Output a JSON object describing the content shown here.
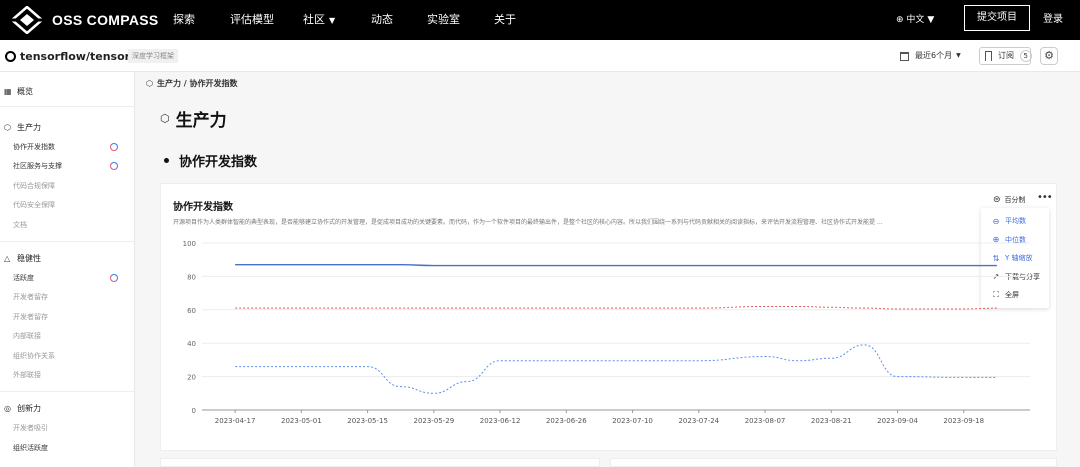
{
  "nav": {
    "logo_text": "OSS COMPASS",
    "items": [
      {
        "label": "探索",
        "dropdown": false
      },
      {
        "label": "评估模型",
        "dropdown": false
      },
      {
        "label": "社区",
        "dropdown": true
      },
      {
        "label": "动态",
        "dropdown": false
      },
      {
        "label": "实验室",
        "dropdown": false
      },
      {
        "label": "关于",
        "dropdown": false
      }
    ],
    "language": "中文",
    "submit_label": "提交项目",
    "login_label": "登录"
  },
  "repo": {
    "name": "tensorflow/tensorflow",
    "tag": "深度学习框架",
    "period_label": "最近6个月",
    "subscribe_label": "订阅",
    "subscribe_count": "5"
  },
  "sidebar": {
    "overview": "概览",
    "groups": [
      {
        "label": "生产力",
        "icon": "cube-icon",
        "items": [
          {
            "label": "协作开发指数",
            "loading": true,
            "active": true
          },
          {
            "label": "社区服务与支撑",
            "loading": true,
            "active": true
          },
          {
            "label": "代码合规保障",
            "loading": false,
            "active": false
          },
          {
            "label": "代码安全保障",
            "loading": false,
            "active": false
          },
          {
            "label": "文档",
            "loading": false,
            "active": false
          }
        ]
      },
      {
        "label": "稳健性",
        "icon": "triangle-icon",
        "items": [
          {
            "label": "活跃度",
            "loading": true,
            "active": true
          },
          {
            "label": "开发者留存",
            "loading": false,
            "active": false
          },
          {
            "label": "开发者留存",
            "loading": false,
            "active": false
          },
          {
            "label": "内部联接",
            "loading": false,
            "active": false
          },
          {
            "label": "组织协作关系",
            "loading": false,
            "active": false
          },
          {
            "label": "外部联接",
            "loading": false,
            "active": false
          }
        ]
      },
      {
        "label": "创新力",
        "icon": "bulb-icon",
        "items": [
          {
            "label": "开发者吸引",
            "loading": false,
            "active": false
          },
          {
            "label": "组织活跃度",
            "loading": false,
            "active": true
          }
        ]
      }
    ]
  },
  "main": {
    "breadcrumb": "生产力 / 协作开发指数",
    "section_title": "生产力",
    "subsection_title": "协作开发指数",
    "card_title": "协作开发指数",
    "card_description": "开源项目作为人类群体智能的典型表现，是否能够建立协作式的开发管理，是促成项目成功的关键要素。而代码，作为一个软件项目的最终输出件，是整个社区的核心内容。所以我们围绕一系列与代码贡献相关的阅读指标，来评估开发流程管理、社区协作式开发能提 ...",
    "percent_label": "百分制",
    "menu": [
      {
        "label": "平均数",
        "icon": "average-icon",
        "active": true
      },
      {
        "label": "中位数",
        "icon": "median-icon",
        "active": true
      },
      {
        "label": "Y 轴缩放",
        "icon": "y-scale-icon",
        "active": true
      },
      {
        "label": "下载与分享",
        "icon": "share-icon",
        "active": false
      },
      {
        "label": "全屏",
        "icon": "fullscreen-icon",
        "active": false
      }
    ]
  },
  "chart_data": {
    "type": "line",
    "title": "",
    "xlabel": "",
    "ylabel": "",
    "ylim": [
      0,
      100
    ],
    "yticks": [
      0,
      20,
      40,
      60,
      80,
      100
    ],
    "grid": true,
    "legend": "none",
    "x_tick_labels": [
      "2023-04-17",
      "2023-05-01",
      "2023-05-15",
      "2023-05-29",
      "2023-06-12",
      "2023-06-26",
      "2023-07-10",
      "2023-07-24",
      "2023-08-07",
      "2023-08-21",
      "2023-09-04",
      "2023-09-18"
    ],
    "x": [
      "2023-04-17",
      "2023-05-01",
      "2023-05-15",
      "2023-05-22",
      "2023-05-29",
      "2023-06-05",
      "2023-06-12",
      "2023-06-26",
      "2023-07-10",
      "2023-07-24",
      "2023-08-07",
      "2023-08-14",
      "2023-08-21",
      "2023-08-28",
      "2023-09-04",
      "2023-09-18",
      "2023-09-25"
    ],
    "series": [
      {
        "color": "#4a6fc9",
        "style": "solid",
        "values": [
          87,
          87,
          87,
          87,
          86.5,
          86.5,
          86.5,
          86.5,
          86.5,
          86.5,
          86.5,
          86.5,
          86.5,
          86.5,
          86.5,
          86.5,
          86.5
        ]
      },
      {
        "color": "#e05a5a",
        "style": "dashed",
        "values": [
          61,
          61,
          61,
          61,
          61,
          61,
          61,
          61,
          61,
          61,
          62,
          62,
          61.5,
          61,
          60.5,
          60.5,
          61
        ]
      },
      {
        "color": "#5b8ff0",
        "style": "dashed",
        "values": [
          26,
          26,
          26,
          14,
          10,
          17,
          29.5,
          29.5,
          29.5,
          29.5,
          32,
          29.5,
          31,
          39,
          20,
          19.5,
          19.5
        ]
      }
    ]
  }
}
